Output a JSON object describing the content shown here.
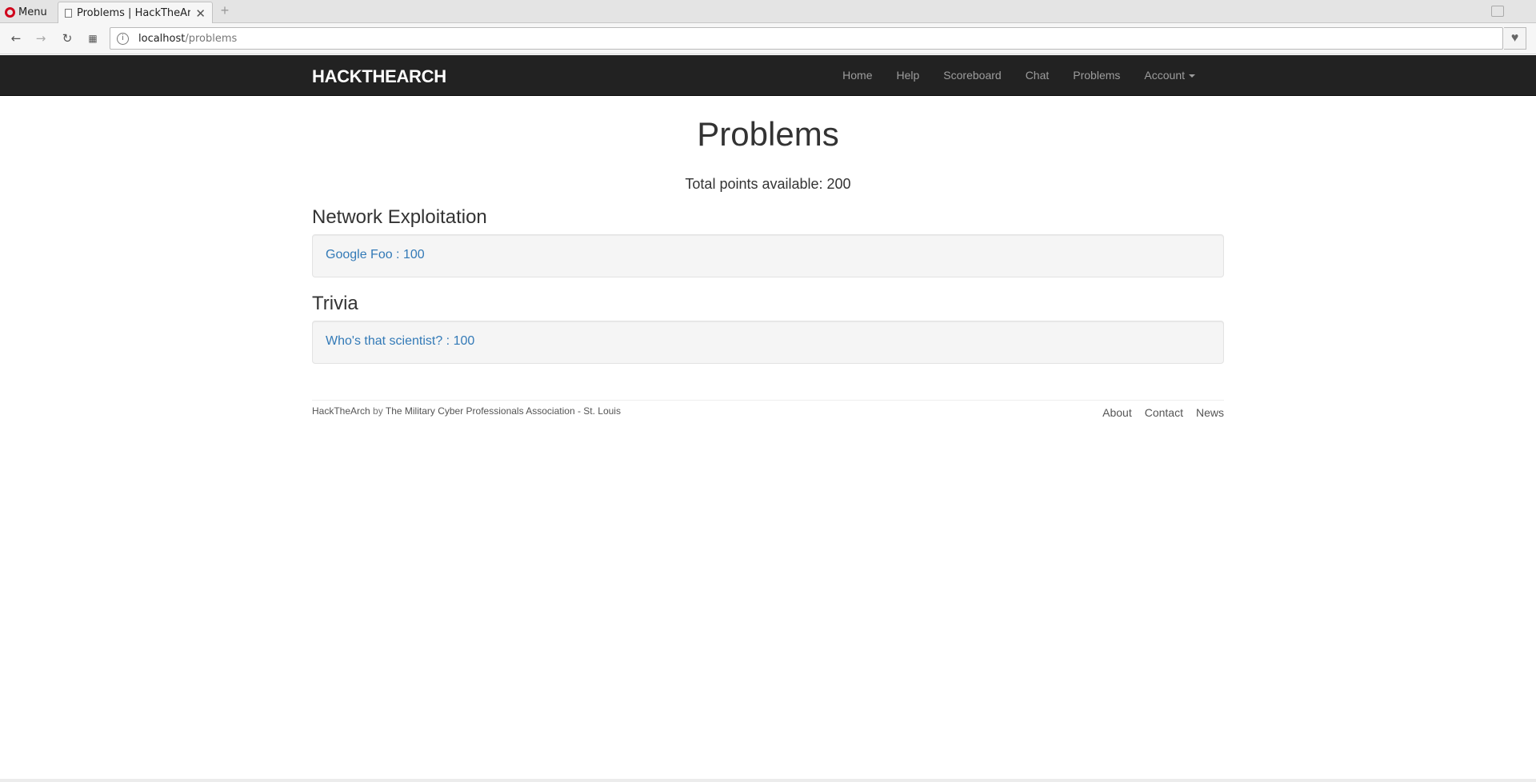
{
  "browser": {
    "menu_label": "Menu",
    "tab_title": "Problems | HackTheArch",
    "tab_close": "✕",
    "new_tab": "+",
    "url_host": "localhost",
    "url_path": "/problems"
  },
  "navbar": {
    "brand": "HACKTHEARCH",
    "links": [
      {
        "label": "Home"
      },
      {
        "label": "Help"
      },
      {
        "label": "Scoreboard"
      },
      {
        "label": "Chat"
      },
      {
        "label": "Problems"
      },
      {
        "label": "Account"
      }
    ]
  },
  "main": {
    "title": "Problems",
    "total_points": "Total points available: 200",
    "categories": [
      {
        "name": "Network Exploitation",
        "problems": [
          {
            "label": "Google Foo : 100"
          }
        ]
      },
      {
        "name": "Trivia",
        "problems": [
          {
            "label": "Who's that scientist? : 100"
          }
        ]
      }
    ]
  },
  "footer": {
    "site_name": "HackTheArch",
    "by": "by",
    "org": "The Military Cyber Professionals Association - St. Louis",
    "links": [
      {
        "label": "About"
      },
      {
        "label": "Contact"
      },
      {
        "label": "News"
      }
    ]
  },
  "colors": {
    "navbar_bg": "#222222",
    "link": "#337ab7",
    "nav_link": "#9d9d9d"
  }
}
